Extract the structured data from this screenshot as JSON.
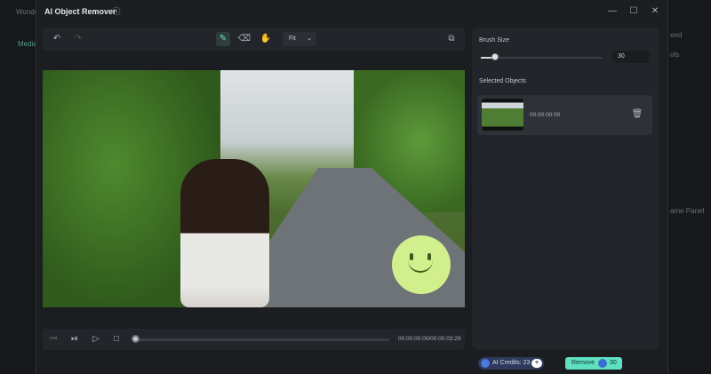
{
  "background_app": {
    "title": "Wonde",
    "tab_media": "Media",
    "right_header": "eed",
    "right_tools": "ols",
    "panel_button": "ame Panel"
  },
  "dialog": {
    "title": "AI Object Remover",
    "fit_label": "Fit"
  },
  "player": {
    "timecode": "00:00:00:00/00:00:03:29",
    "progress": 0
  },
  "brush": {
    "label": "Brush Size",
    "value": "30"
  },
  "selected": {
    "label": "Selected Objects",
    "items": [
      {
        "timecode": "00:00:00:00"
      }
    ]
  },
  "footer": {
    "credits_label": "AI Credits: 23",
    "remove_label": "Remove",
    "remove_cost": "30"
  },
  "colors": {
    "accent": "#5fe0c0",
    "smiley": "#d2ef8e"
  }
}
